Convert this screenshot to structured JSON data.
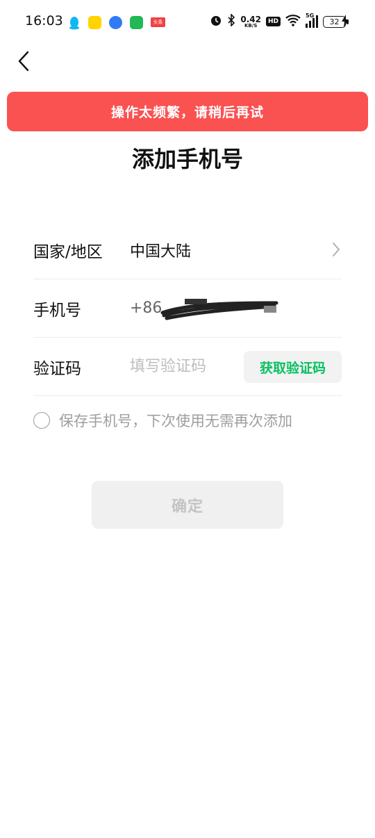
{
  "status_bar": {
    "time": "16:03",
    "net_speed_value": "0.42",
    "net_speed_unit": "KB/S",
    "hd_label": "HD",
    "network_label": "5G",
    "battery": "32",
    "app_icons": [
      "qq-icon",
      "app-icon-yellow",
      "app-icon-blue",
      "app-icon-green",
      "toutiao-icon"
    ],
    "toutiao_label": "头条"
  },
  "toast": {
    "message": "操作太频繁，请稍后再试",
    "color": "#fa5151"
  },
  "title": "添加手机号",
  "form": {
    "region": {
      "label": "国家/地区",
      "value": "中国大陆"
    },
    "phone": {
      "label": "手机号",
      "prefix": "+86"
    },
    "code": {
      "label": "验证码",
      "placeholder": "填写验证码",
      "get_code_button": "获取验证码"
    }
  },
  "save_option": "保存手机号，下次使用无需再次添加",
  "confirm_button": "确定",
  "colors": {
    "accent_green": "#07c160",
    "toast_red": "#fa5151",
    "muted_text": "#9e9e9e"
  }
}
